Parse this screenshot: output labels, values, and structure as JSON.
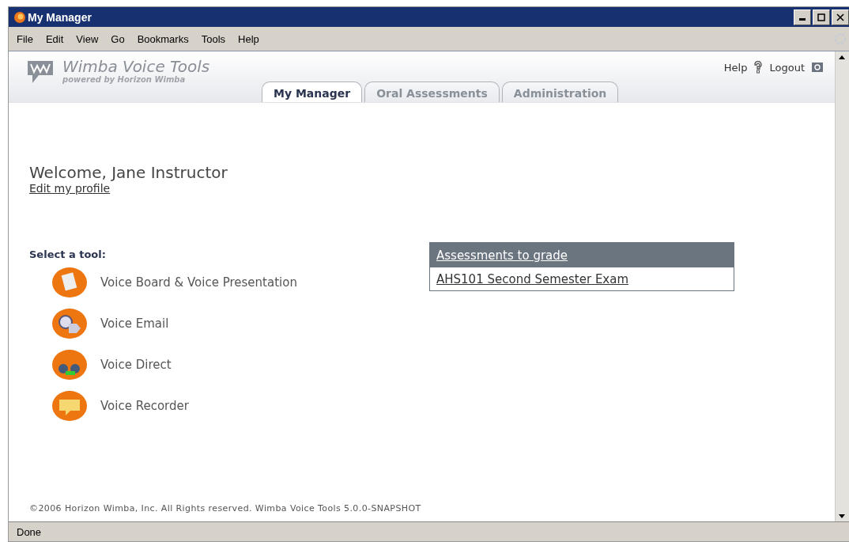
{
  "window": {
    "title": "My Manager"
  },
  "menu": [
    "File",
    "Edit",
    "View",
    "Go",
    "Bookmarks",
    "Tools",
    "Help"
  ],
  "header": {
    "brand": "Wimba Voice Tools",
    "tagline": "powered by Horizon Wimba",
    "help": "Help",
    "logout": "Logout"
  },
  "tabs": [
    {
      "label": "My Manager",
      "selected": true
    },
    {
      "label": "Oral Assessments",
      "selected": false
    },
    {
      "label": "Administration",
      "selected": false
    }
  ],
  "welcome": {
    "greeting": "Welcome, Jane Instructor",
    "profile_link": "Edit my profile"
  },
  "tools": {
    "heading": "Select a tool:",
    "items": [
      "Voice Board & Voice Presentation",
      "Voice Email",
      "Voice Direct",
      "Voice Recorder"
    ]
  },
  "assessments": {
    "heading": "Assessments to grade",
    "items": [
      "AHS101 Second Semester Exam"
    ]
  },
  "footer": "©2006 Horizon Wimba, Inc. All Rights reserved. Wimba Voice Tools 5.0.0-SNAPSHOT",
  "status_bar": "Done"
}
